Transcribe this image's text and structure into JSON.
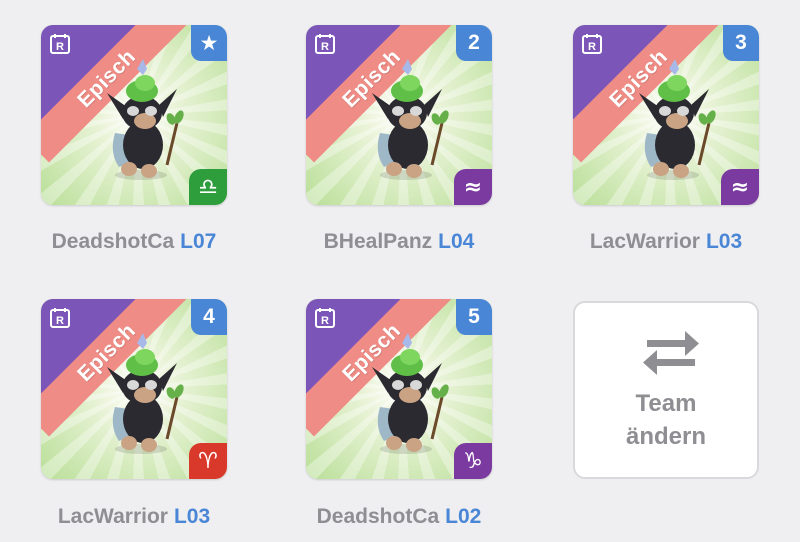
{
  "colors": {
    "background": "#efeff1",
    "level_blue": "#4a86d6",
    "rarity_ribbon": "#ef8c85",
    "element_purple": "#7b56b8"
  },
  "pets": [
    {
      "rarity": "Episch",
      "slot": "★",
      "slot_icon": "star-icon",
      "zodiac": "♎",
      "zodiac_name": "libra-icon",
      "zodiac_color": "#2e9d3c",
      "name": "DeadshotCa",
      "level": "L07"
    },
    {
      "rarity": "Episch",
      "slot": "2",
      "slot_icon": "",
      "zodiac": "≈",
      "zodiac_name": "aquarius-icon",
      "zodiac_color": "#7b3aa0",
      "name": "BHealPanz",
      "level": "L04"
    },
    {
      "rarity": "Episch",
      "slot": "3",
      "slot_icon": "",
      "zodiac": "≈",
      "zodiac_name": "aquarius-icon",
      "zodiac_color": "#7b3aa0",
      "name": "LacWarrior",
      "level": "L03"
    },
    {
      "rarity": "Episch",
      "slot": "4",
      "slot_icon": "",
      "zodiac": "♈",
      "zodiac_name": "aries-icon",
      "zodiac_color": "#d8392b",
      "name": "LacWarrior",
      "level": "L03"
    },
    {
      "rarity": "Episch",
      "slot": "5",
      "slot_icon": "",
      "zodiac": "♑",
      "zodiac_name": "capricorn-icon",
      "zodiac_color": "#7b3aa0",
      "name": "DeadshotCa",
      "level": "L02"
    }
  ],
  "team_button": {
    "line1": "Team",
    "line2": "ändern",
    "icon": "swap-arrows-icon"
  }
}
